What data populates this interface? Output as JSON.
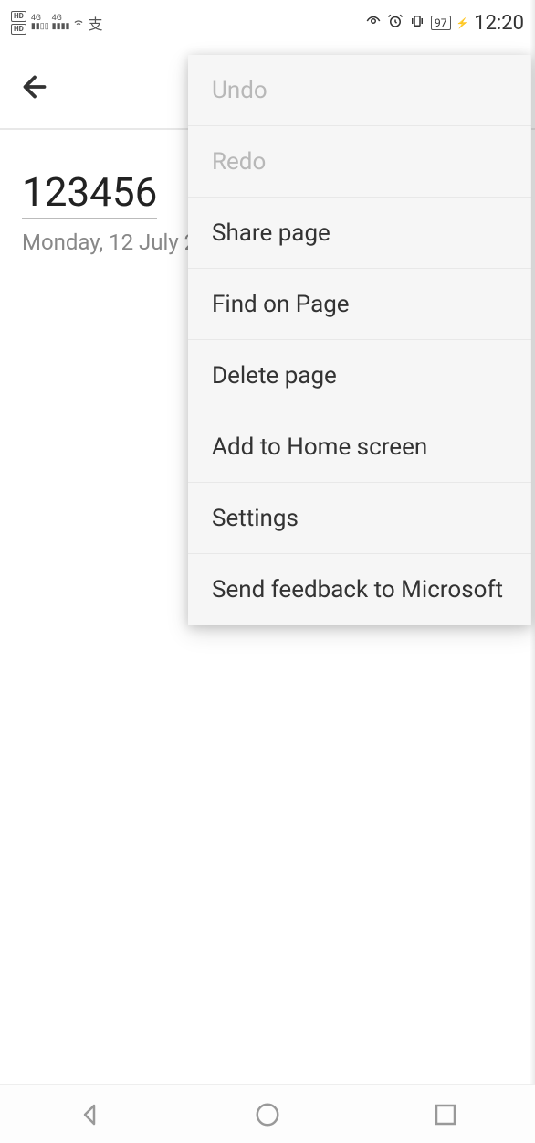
{
  "status_bar": {
    "left_label": "4G",
    "battery": "97",
    "time": "12:20"
  },
  "page": {
    "title": "123456",
    "date": "Monday, 12 July 2"
  },
  "menu": {
    "items": [
      {
        "label": "Undo",
        "disabled": true
      },
      {
        "label": "Redo",
        "disabled": true
      },
      {
        "label": "Share page",
        "disabled": false
      },
      {
        "label": "Find on Page",
        "disabled": false
      },
      {
        "label": "Delete page",
        "disabled": false
      },
      {
        "label": "Add to Home screen",
        "disabled": false
      },
      {
        "label": "Settings",
        "disabled": false
      },
      {
        "label": "Send feedback to Microsoft",
        "disabled": false
      }
    ]
  }
}
